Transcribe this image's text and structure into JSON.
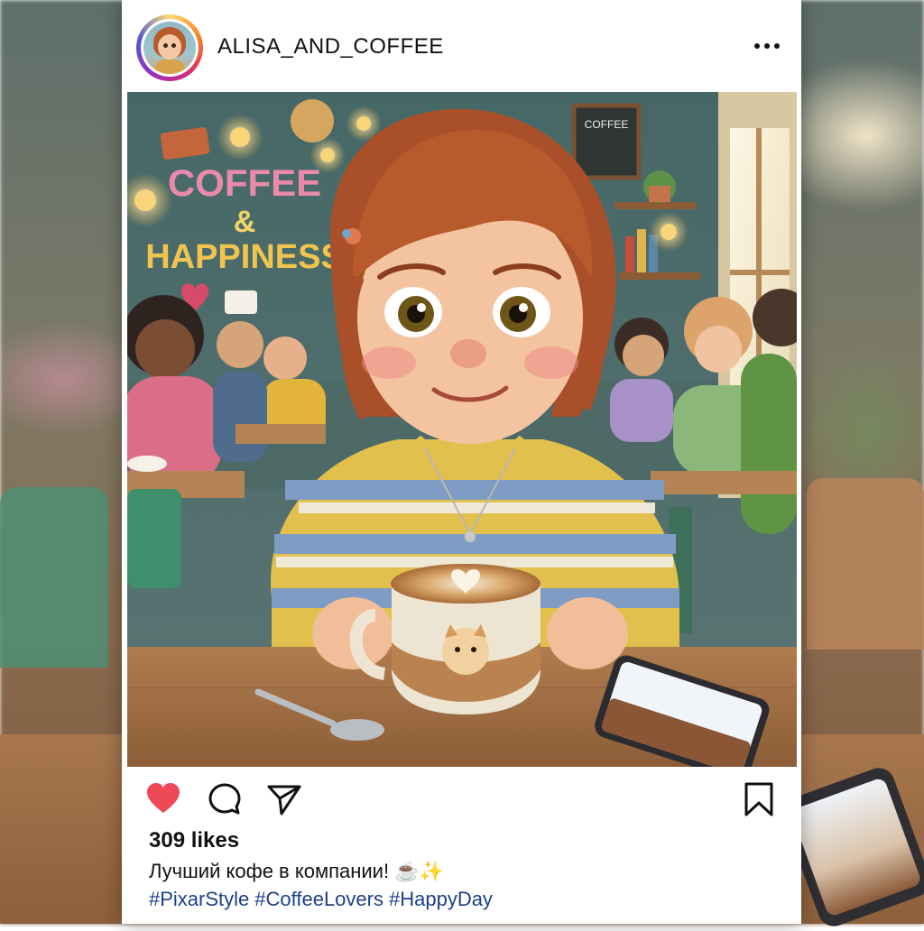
{
  "post": {
    "username": "ALISA_AND_COFFEE",
    "likes_text": "309 likes",
    "caption": "Лучший кофе в компании! ☕✨",
    "hashtags": [
      "#PixarStyle",
      "#CoffeeLovers",
      "#HappyDay"
    ]
  },
  "image": {
    "wall_sign_line1": "COFFEE",
    "wall_sign_line2": "&",
    "wall_sign_line3": "HAPPINESS",
    "chalkboard_text": "COFFEE"
  },
  "icons": {
    "avatar": "avatar-icon",
    "more": "more-options-icon",
    "like": "heart-icon",
    "comment": "comment-icon",
    "share": "share-icon",
    "save": "bookmark-icon"
  },
  "colors": {
    "heart": "#ed4956",
    "hashtag": "#1d3f8a",
    "sweater_yellow": "#e2c04e",
    "sweater_blue": "#7f9cc4",
    "hair": "#b85a2c"
  }
}
